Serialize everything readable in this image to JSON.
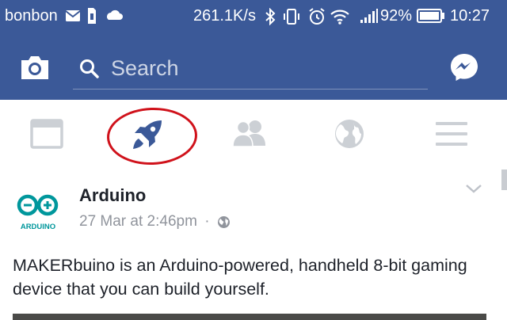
{
  "status_bar": {
    "carrier": "bonbon",
    "net_speed": "261.1K/s",
    "battery_percent": "92%",
    "time": "10:27",
    "icons": [
      "mail-icon",
      "sim-icon",
      "cloud-icon",
      "bluetooth-icon",
      "vibrate-icon",
      "alarm-icon",
      "wifi-icon",
      "signal-icon",
      "battery-icon"
    ]
  },
  "header": {
    "camera_icon": "camera-icon",
    "search_placeholder": "Search",
    "messenger_icon": "messenger-icon"
  },
  "tabs": [
    {
      "name": "news-feed",
      "icon": "newsfeed-icon",
      "active": false
    },
    {
      "name": "explore",
      "icon": "rocket-icon",
      "active": true
    },
    {
      "name": "friends",
      "icon": "friends-icon",
      "active": false
    },
    {
      "name": "notifications",
      "icon": "globe-icon",
      "active": false
    },
    {
      "name": "menu",
      "icon": "hamburger-icon",
      "active": false
    }
  ],
  "post": {
    "avatar_text": "ARDUINO",
    "author": "Arduino",
    "timestamp": "27 Mar at 2:46pm",
    "separator": "·",
    "privacy_icon": "globe-icon",
    "body": "MAKERbuino is an Arduino-powered, handheld 8-bit gaming device that you can build yourself."
  },
  "colors": {
    "brand": "#3b5998",
    "active_tab": "#3b5998",
    "inactive_tab": "#ccd0d5",
    "annotation_circle": "#d0121b",
    "arduino_teal": "#00979c"
  }
}
